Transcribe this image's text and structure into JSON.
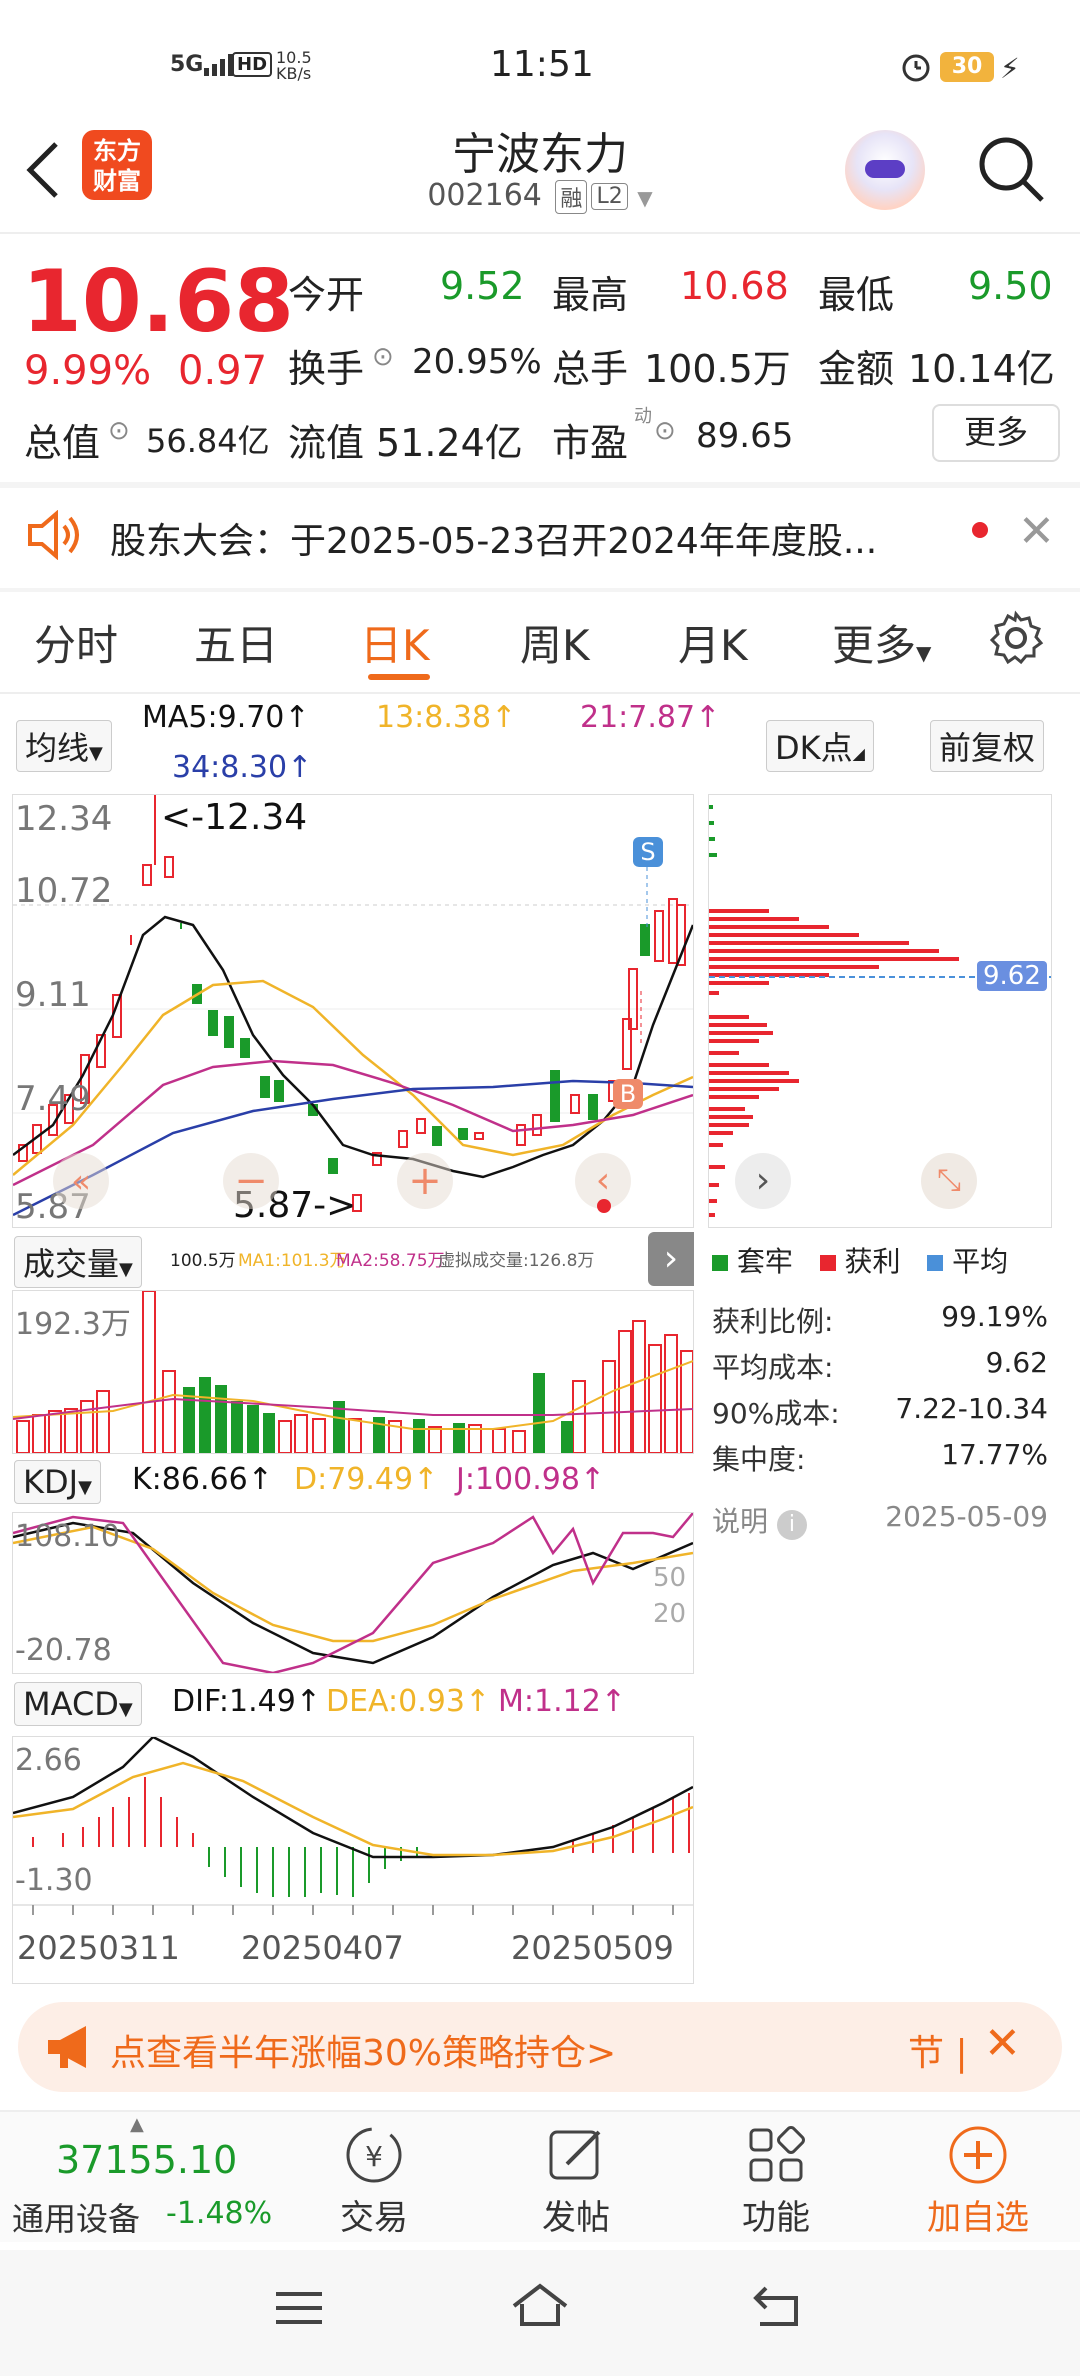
{
  "status_bar": {
    "network": "5G",
    "hd": "HD",
    "speed_value": "10.5",
    "speed_unit": "KB/s",
    "time": "11:51",
    "battery": "30"
  },
  "header": {
    "logo_line1": "东方",
    "logo_line2": "财富",
    "stock_name": "宁波东力",
    "stock_code": "002164",
    "tag_margin": "融",
    "tag_level": "L2"
  },
  "quote": {
    "price": "10.68",
    "change_pct": "9.99%",
    "change": "0.97",
    "open_label": "今开",
    "open": "9.52",
    "high_label": "最高",
    "high": "10.68",
    "low_label": "最低",
    "low": "9.50",
    "turnover_label": "换手",
    "turnover": "20.95%",
    "volume_label": "总手",
    "volume": "100.5万",
    "amount_label": "金额",
    "amount": "10.14亿",
    "mktcap_label": "总值",
    "mktcap": "56.84亿",
    "float_label": "流值",
    "float_cap": "51.24亿",
    "pe_label": "市盈",
    "pe_sup": "动",
    "pe": "89.65",
    "more_label": "更多"
  },
  "notice": {
    "text": "股东大会：于2025-05-23召开2024年年度股..."
  },
  "tabs": [
    {
      "label": "分时"
    },
    {
      "label": "五日"
    },
    {
      "label": "日K"
    },
    {
      "label": "周K"
    },
    {
      "label": "月K"
    },
    {
      "label": "更多"
    }
  ],
  "ma": {
    "selector": "均线",
    "ma5": "MA5:9.70↑",
    "ma13": "13:8.38↑",
    "ma21": "21:7.87↑",
    "ma34": "34:8.30↑",
    "dk": "DK点",
    "adjust": "前复权"
  },
  "kline": {
    "y_top": "12.34",
    "y_2": "10.72",
    "y_3": "9.11",
    "y_4": "7.49",
    "y_bottom": "5.87",
    "max_label": "<-12.34",
    "min_label": "5.87->",
    "sig_s": "S",
    "sig_b": "B",
    "chip_cost": "9.62"
  },
  "chips": {
    "legend_trap": "套牢",
    "legend_profit": "获利",
    "legend_avg": "平均",
    "profit_ratio_label": "获利比例:",
    "profit_ratio": "99.19%",
    "avg_cost_label": "平均成本:",
    "avg_cost": "9.62",
    "cost90_label": "90%成本:",
    "cost90": "7.22-10.34",
    "concentration_label": "集中度:",
    "concentration": "17.77%",
    "note_label": "说明",
    "date": "2025-05-09"
  },
  "volume": {
    "selector": "成交量",
    "vol": "100.5万",
    "ma1": "MA1:101.3万",
    "ma2": "MA2:58.75万",
    "virtual": "虚拟成交量:126.8万",
    "y_top": "192.3万"
  },
  "kdj": {
    "selector": "KDJ",
    "k": "K:86.66↑",
    "d": "D:79.49↑",
    "j": "J:100.98↑",
    "y_top": "108.10",
    "y_bottom": "-20.78",
    "lvl50": "50",
    "lvl20": "20"
  },
  "macd": {
    "selector": "MACD",
    "dif": "DIF:1.49↑",
    "dea": "DEA:0.93↑",
    "m": "M:1.12↑",
    "y_top": "2.66",
    "y_bottom": "-1.30"
  },
  "dates": [
    "20250311",
    "20250407",
    "20250509"
  ],
  "banner": {
    "text": "点查看半年涨幅30%策略持仓>",
    "right": "节 |"
  },
  "bottom_nav": {
    "index_value": "37155.10",
    "index_name": "通用设备",
    "index_change": "-1.48%",
    "trade": "交易",
    "post": "发帖",
    "function": "功能",
    "add": "加自选"
  },
  "colors": {
    "up": "#e8262f",
    "down": "#1a9a2a",
    "accent": "#ef6a1b",
    "ma5": "#111111",
    "ma13": "#f0b429",
    "ma21": "#c0308a",
    "ma34": "#2a3fa8"
  }
}
